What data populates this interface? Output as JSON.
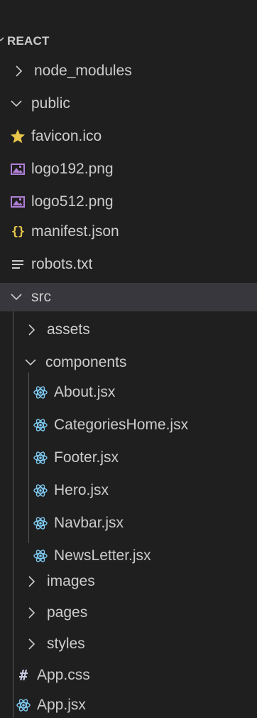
{
  "explorer": {
    "section_title": "REACT",
    "items": [
      {
        "label": "node_modules"
      },
      {
        "label": "public"
      },
      {
        "label": "favicon.ico"
      },
      {
        "label": "logo192.png"
      },
      {
        "label": "logo512.png"
      },
      {
        "label": "manifest.json"
      },
      {
        "label": "robots.txt"
      },
      {
        "label": "src"
      },
      {
        "label": "assets"
      },
      {
        "label": "components"
      },
      {
        "label": "About.jsx"
      },
      {
        "label": "CategoriesHome.jsx"
      },
      {
        "label": "Footer.jsx"
      },
      {
        "label": "Hero.jsx"
      },
      {
        "label": "Navbar.jsx"
      },
      {
        "label": "NewsLetter.jsx"
      },
      {
        "label": "images"
      },
      {
        "label": "pages"
      },
      {
        "label": "styles"
      },
      {
        "label": "App.css"
      },
      {
        "label": "App.jsx"
      }
    ]
  },
  "icons": {
    "collapsed": "chevron-right-icon",
    "expanded": "chevron-down-icon",
    "favicon": "star-icon",
    "image": "image-file-icon",
    "json": "json-braces-icon",
    "text": "text-lines-icon",
    "react": "react-atom-icon",
    "css": "css-hash-icon"
  },
  "colors": {
    "background": "#1f1f1f",
    "text": "#cccccc",
    "selected_row": "#37373d",
    "star": "#e8c74a",
    "json": "#e8c74a",
    "react": "#7dc8f0",
    "image": "#b07fd6",
    "indent_guide": "#585858"
  }
}
